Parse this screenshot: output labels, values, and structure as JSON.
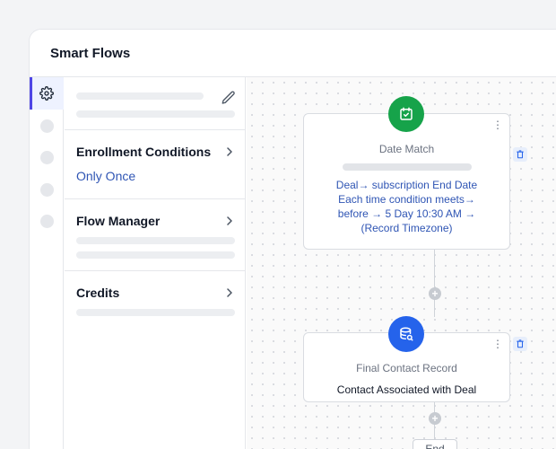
{
  "app": {
    "title": "Smart Flows"
  },
  "panel": {
    "sections": [
      {
        "title": "Enrollment Conditions",
        "value": "Only Once"
      },
      {
        "title": "Flow Manager"
      },
      {
        "title": "Credits"
      }
    ]
  },
  "flow": {
    "date_match": {
      "title": "Date Match",
      "line1": "Deal→ subscription End Date",
      "line2": "Each time condition meets→",
      "line3": "before → 5 Day 10:30 AM →",
      "line4": "(Record Timezone)"
    },
    "final_contact": {
      "title": "Final Contact Record",
      "action": "Contact Associated with Deal"
    },
    "end_label": "End"
  },
  "colors": {
    "accent": "#4f46e5",
    "date_match_icon": "#16a34a",
    "final_contact_icon": "#2563eb",
    "link_blue": "#2f55b4"
  },
  "icons": {
    "rail_top": "gear-icon",
    "date_match": "calendar-check-icon",
    "final_contact": "database-search-icon"
  }
}
